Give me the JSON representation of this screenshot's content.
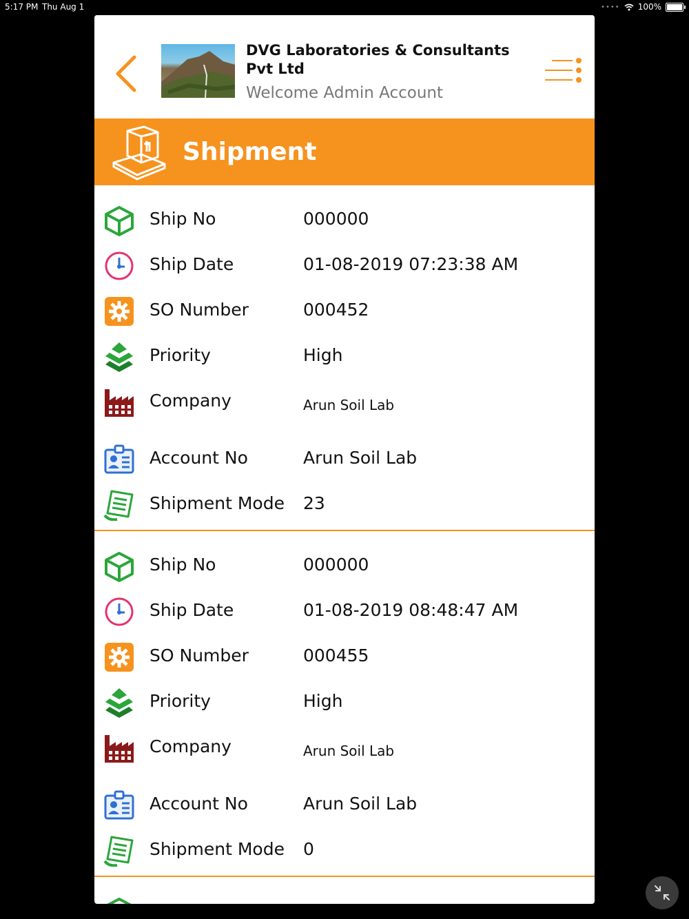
{
  "status_bar": {
    "time": "5:17 PM",
    "date": "Thu Aug 1",
    "battery": "100%"
  },
  "header": {
    "title": "DVG Laboratories & Consultants Pvt Ltd",
    "subtitle": "Welcome Admin Account"
  },
  "banner": {
    "title": "Shipment"
  },
  "labels": {
    "ship_no": "Ship No",
    "ship_date": "Ship Date",
    "so_number": "SO Number",
    "priority": "Priority",
    "company": "Company",
    "account_no": "Account No",
    "shipment_mode": "Shipment Mode"
  },
  "records": [
    {
      "ship_no": "000000",
      "ship_date": "01-08-2019 07:23:38 AM",
      "so_number": "000452",
      "priority": "High",
      "company": "Arun Soil Lab",
      "account_no": "Arun Soil Lab",
      "shipment_mode": "23"
    },
    {
      "ship_no": "000000",
      "ship_date": "01-08-2019 08:48:47 AM",
      "so_number": "000455",
      "priority": "High",
      "company": "Arun Soil Lab",
      "account_no": "Arun Soil Lab",
      "shipment_mode": "0"
    }
  ],
  "colors": {
    "accent": "#f6921e",
    "green": "#2aa63a",
    "pink": "#e5336b",
    "maroon": "#8b1a1a",
    "blue": "#2f6fd1"
  },
  "icons": [
    "back-chevron-icon",
    "menu-icon",
    "shipment-box-icon",
    "cube-icon",
    "clock-icon",
    "gear-icon",
    "layers-icon",
    "factory-icon",
    "id-card-icon",
    "document-icon",
    "collapse-icon"
  ]
}
